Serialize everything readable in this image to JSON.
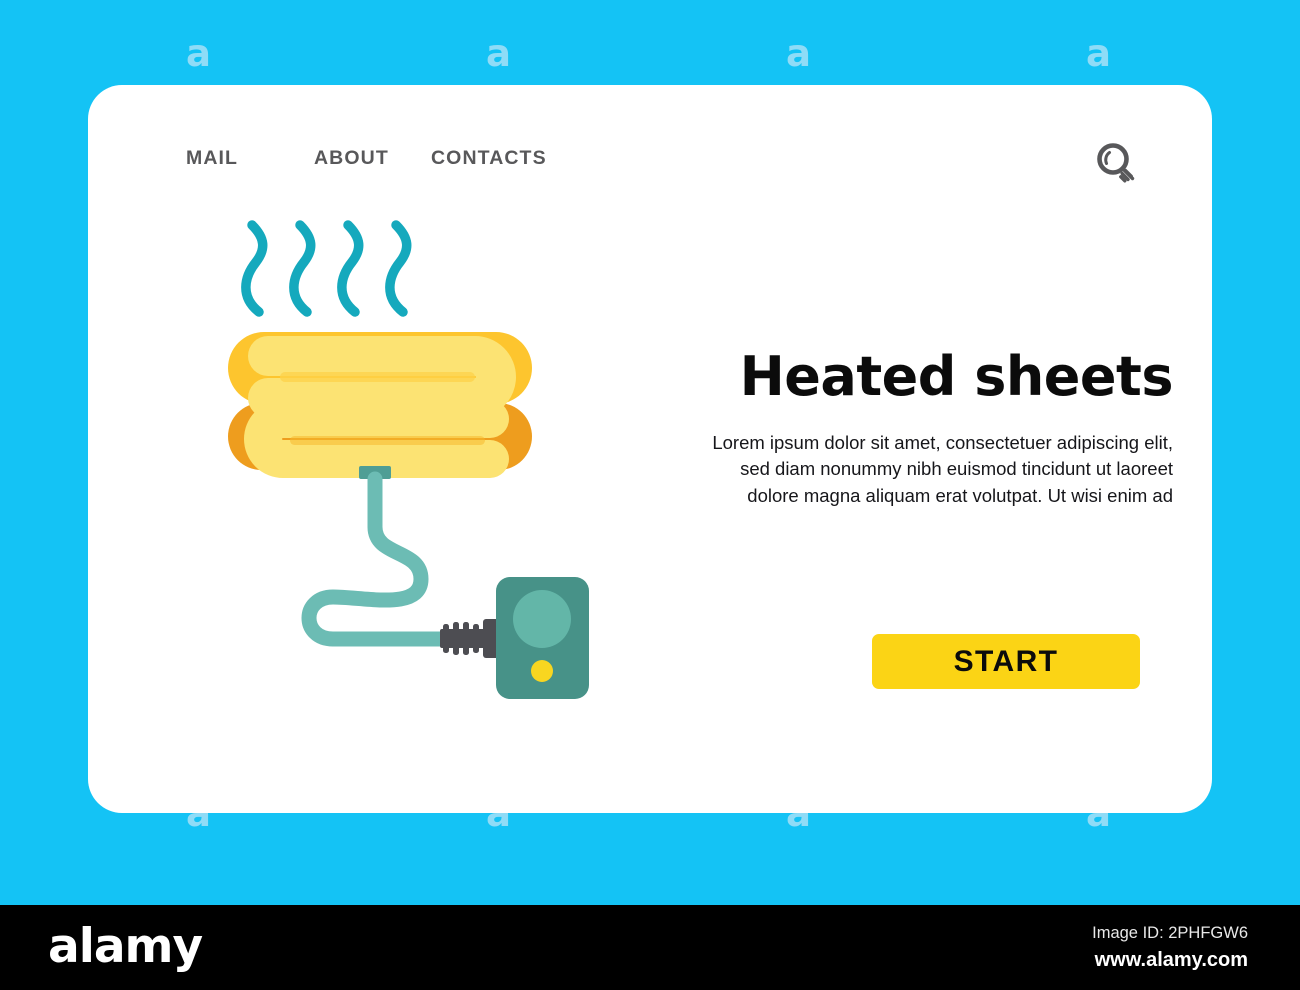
{
  "page": {
    "background_color": "#14c3f5",
    "card_color": "#ffffff",
    "watermark_letter": "a",
    "watermark_color": "#8fdcf7"
  },
  "nav": {
    "items": [
      {
        "label": "MAIL"
      },
      {
        "label": "ABOUT"
      },
      {
        "label": "CONTACTS"
      }
    ],
    "search_icon": "search-icon"
  },
  "hero": {
    "headline": "Heated sheets",
    "body": "Lorem ipsum dolor sit amet, consectetuer adipiscing elit, sed diam nonummy nibh euismod tincidunt ut laoreet dolore magna aliquam erat volutpat. Ut wisi enim ad",
    "cta_label": "START",
    "cta_color": "#fbd415",
    "headline_color": "#0b0b0b"
  },
  "illustration": {
    "name": "heated-blanket-with-controller",
    "steam_color": "#15a9bd",
    "blanket_top_color": "#fdc52e",
    "blanket_bottom_color": "#ee9d1e",
    "blanket_fold_color": "#fce373",
    "cord_color": "#6cbcb4",
    "controller_body_color": "#479288",
    "controller_dial_color": "#63b6a8",
    "controller_led_color": "#f8d620",
    "connector_color": "#4d4d52",
    "steam_wisp_count": 4
  },
  "footer": {
    "brand": "alamy",
    "image_id": "Image ID: 2PHFGW6",
    "url": "www.alamy.com",
    "background_color": "#000000"
  }
}
